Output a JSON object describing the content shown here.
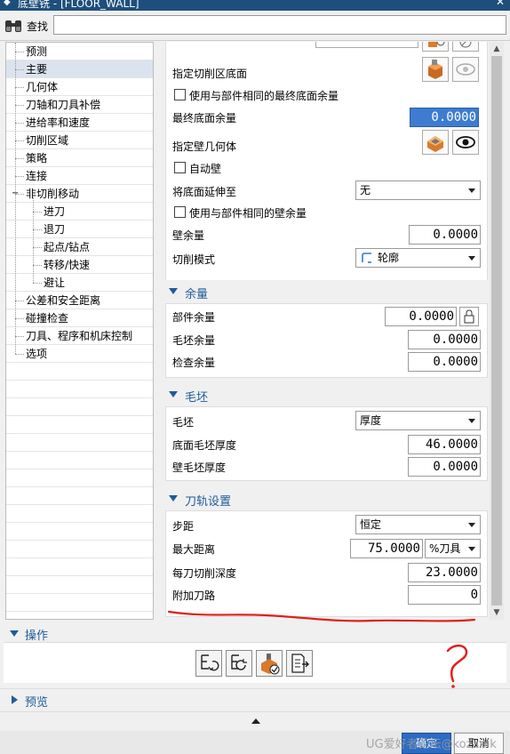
{
  "window": {
    "title": "底壁铣 - [FLOOR_WALL]"
  },
  "search": {
    "label": "查找",
    "value": ""
  },
  "nav": {
    "items": [
      {
        "label": "预测",
        "level": 1
      },
      {
        "label": "主要",
        "level": 1,
        "selected": true
      },
      {
        "label": "几何体",
        "level": 1
      },
      {
        "label": "刀轴和刀具补偿",
        "level": 1
      },
      {
        "label": "进给率和速度",
        "level": 1
      },
      {
        "label": "切削区域",
        "level": 1
      },
      {
        "label": "策略",
        "level": 1
      },
      {
        "label": "连接",
        "level": 1
      },
      {
        "label": "非切削移动",
        "level": 1,
        "expanded": true
      },
      {
        "label": "进刀",
        "level": 2
      },
      {
        "label": "退刀",
        "level": 2
      },
      {
        "label": "起点/钻点",
        "level": 2
      },
      {
        "label": "转移/快速",
        "level": 2
      },
      {
        "label": "避让",
        "level": 2
      },
      {
        "label": "公差和安全距离",
        "level": 1
      },
      {
        "label": "碰撞检查",
        "level": 1
      },
      {
        "label": "刀具、程序和机床控制",
        "level": 1
      },
      {
        "label": "选项",
        "level": 1
      }
    ]
  },
  "geometry": {
    "specify_floor_label": "指定切削区底面",
    "use_same_floor_stock_label": "使用与部件相同的最终底面余量",
    "final_floor_stock_label": "最终底面余量",
    "final_floor_stock_value": "0.0000",
    "specify_wall_label": "指定壁几何体",
    "auto_wall_label": "自动壁",
    "extend_floor_label": "将底面延伸至",
    "extend_floor_value": "无",
    "use_same_wall_stock_label": "使用与部件相同的壁余量",
    "wall_stock_label": "壁余量",
    "wall_stock_value": "0.0000",
    "cut_pattern_label": "切削模式",
    "cut_pattern_value": "轮廓"
  },
  "stock": {
    "title": "余量",
    "part_stock_label": "部件余量",
    "part_stock_value": "0.0000",
    "blank_stock_label": "毛坯余量",
    "blank_stock_value": "0.0000",
    "check_stock_label": "检查余量",
    "check_stock_value": "0.0000"
  },
  "blank": {
    "title": "毛坯",
    "blank_label": "毛坯",
    "blank_value": "厚度",
    "floor_blank_label": "底面毛坯厚度",
    "floor_blank_value": "46.0000",
    "wall_blank_label": "壁毛坯厚度",
    "wall_blank_value": "0.0000"
  },
  "toolpath": {
    "title": "刀轨设置",
    "stepover_label": "步距",
    "stepover_value": "恒定",
    "max_distance_label": "最大距离",
    "max_distance_value": "75.0000",
    "max_distance_unit": "%刀具",
    "depth_per_cut_label": "每刀切削深度",
    "depth_per_cut_value": "23.0000",
    "additional_passes_label": "附加刀路",
    "additional_passes_value": "0"
  },
  "operations": {
    "title": "操作"
  },
  "preview": {
    "title": "预览"
  },
  "footer": {
    "ok": "确定",
    "cancel": "取消",
    "watermark": "UG爱好者论坛@kozanik"
  },
  "annotation": {
    "mark": "?",
    "color": "#e0201c"
  }
}
